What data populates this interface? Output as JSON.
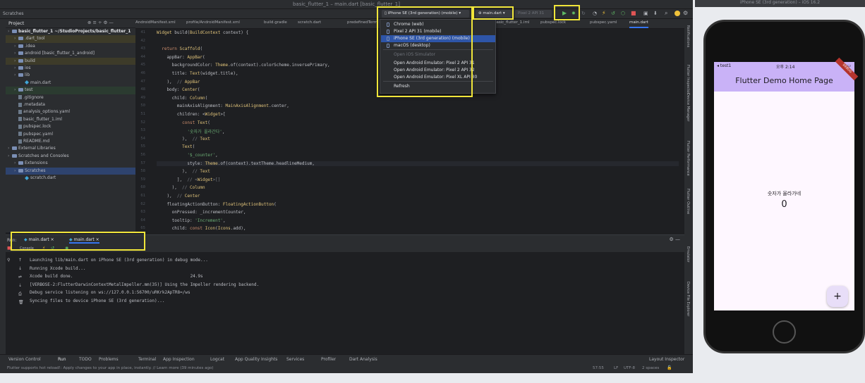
{
  "window": {
    "title": "basic_flutter_1 – main.dart [basic_flutter_1]",
    "scratches_label": "Scratches"
  },
  "toolbar": {
    "device_selector": "iPhone SE (3rd generation) (mobile)",
    "config_selector": "main.dart",
    "avd_selector": "Pixel 2 API 31"
  },
  "device_menu": {
    "items": [
      {
        "label": "Chrome (web)"
      },
      {
        "label": "Pixel 2 API 31 (mobile)"
      },
      {
        "label": "iPhone SE (3rd generation) (mobile)",
        "selected": true
      },
      {
        "label": "macOS (desktop)"
      },
      {
        "label": "Open iOS Simulator",
        "disabled": true
      },
      {
        "label": "Open Android Emulator: Pixel 2 API 31"
      },
      {
        "label": "Open Android Emulator: Pixel 2 API 32"
      },
      {
        "label": "Open Android Emulator: Pixel XL API 30"
      },
      {
        "label": "Refresh"
      }
    ]
  },
  "project": {
    "header": "Project",
    "tree": [
      {
        "label": "basic_flutter_1  ~/StudioProjects/basic_flutter_1",
        "indent": 0,
        "kind": "root"
      },
      {
        "label": ".dart_tool",
        "indent": 1,
        "kind": "folder",
        "bg": "olive"
      },
      {
        "label": ".idea",
        "indent": 1,
        "kind": "folder"
      },
      {
        "label": "android [basic_flutter_1_android]",
        "indent": 1,
        "kind": "folder"
      },
      {
        "label": "build",
        "indent": 1,
        "kind": "folder",
        "bg": "olive"
      },
      {
        "label": "ios",
        "indent": 1,
        "kind": "folder"
      },
      {
        "label": "lib",
        "indent": 1,
        "kind": "folder"
      },
      {
        "label": "main.dart",
        "indent": 2,
        "kind": "dart"
      },
      {
        "label": "test",
        "indent": 1,
        "kind": "folder",
        "bg": "green"
      },
      {
        "label": ".gitignore",
        "indent": 1,
        "kind": "file"
      },
      {
        "label": ".metadata",
        "indent": 1,
        "kind": "file"
      },
      {
        "label": "analysis_options.yaml",
        "indent": 1,
        "kind": "file"
      },
      {
        "label": "basic_flutter_1.iml",
        "indent": 1,
        "kind": "file"
      },
      {
        "label": "pubspec.lock",
        "indent": 1,
        "kind": "file"
      },
      {
        "label": "pubspec.yaml",
        "indent": 1,
        "kind": "file"
      },
      {
        "label": "README.md",
        "indent": 1,
        "kind": "file"
      },
      {
        "label": "External Libraries",
        "indent": 0,
        "kind": "folder"
      },
      {
        "label": "Scratches and Consoles",
        "indent": 0,
        "kind": "folder"
      },
      {
        "label": "Extensions",
        "indent": 1,
        "kind": "folder"
      },
      {
        "label": "Scratches",
        "indent": 1,
        "kind": "folder",
        "bg": "sel"
      },
      {
        "label": "scratch.dart",
        "indent": 2,
        "kind": "dart"
      }
    ]
  },
  "editor_tabs": [
    "AndroidManifest.xml",
    "profile/AndroidManifest.xml",
    "build.gradle",
    "scratch.dart",
    "predefinedTerm",
    "basic_flutter_1.iml",
    "pubspec.lock",
    "pubspec.yaml",
    "main.dart"
  ],
  "code": [
    {
      "n": "41",
      "text": "Widget build(BuildContext context) {"
    },
    {
      "n": "42",
      "text": ""
    },
    {
      "n": "43",
      "text": "  return Scaffold("
    },
    {
      "n": "44",
      "text": "    appBar: AppBar("
    },
    {
      "n": "45",
      "text": "      backgroundColor: Theme.of(context).colorScheme.inversePrimary,"
    },
    {
      "n": "46",
      "text": "      title: Text(widget.title),"
    },
    {
      "n": "47",
      "text": "    ),  // AppBar"
    },
    {
      "n": "48",
      "text": "    body: Center("
    },
    {
      "n": "49",
      "text": "      child: Column("
    },
    {
      "n": "50",
      "text": "        mainAxisAlignment: MainAxisAlignment.center,"
    },
    {
      "n": "51",
      "text": "        children: <Widget>["
    },
    {
      "n": "52",
      "text": "          const Text("
    },
    {
      "n": "53",
      "text": "            '숫자가 올라간다',"
    },
    {
      "n": "54",
      "text": "          ),  // Text"
    },
    {
      "n": "55",
      "text": "          Text("
    },
    {
      "n": "56",
      "text": "            '$_counter',"
    },
    {
      "n": "57",
      "text": "            style: Theme.of(context).textTheme.headlineMedium,"
    },
    {
      "n": "58",
      "text": "          ),  // Text"
    },
    {
      "n": "59",
      "text": "        ],  // <Widget>[]"
    },
    {
      "n": "60",
      "text": "      ),  // Column"
    },
    {
      "n": "61",
      "text": "    ),  // Center"
    },
    {
      "n": "62",
      "text": "    floatingActionButton: FloatingActionButton("
    },
    {
      "n": "63",
      "text": "      onPressed: _incrementCounter,"
    },
    {
      "n": "64",
      "text": "      tooltip: 'Increment',"
    },
    {
      "n": "65",
      "text": "      child: const Icon(Icons.add),"
    }
  ],
  "run": {
    "label": "Run:",
    "tabs": [
      "main.dart",
      "main.dart"
    ],
    "console_tab": "Console",
    "lines": [
      "Launching lib/main.dart on iPhone SE (3rd generation) in debug mode...",
      "Running Xcode build...",
      "Xcode build done.                                              24.9s",
      "[VERBOSE-2:FlutterDarwinContextMetalImpeller.mm(35)] Using the Impeller rendering backend.",
      "Debug service listening on ws://127.0.0.1:56700/uRKrk2ApTR8=/ws",
      "Syncing files to device iPhone SE (3rd generation)..."
    ]
  },
  "bottom_tools": [
    "Version Control",
    "Run",
    "TODO",
    "Problems",
    "Terminal",
    "App Inspection",
    "Logcat",
    "App Quality Insights",
    "Services",
    "Profiler",
    "Dart Analysis",
    "Layout Inspector"
  ],
  "status": {
    "message": "Flutter supports hot reload!: Apply changes to your app in place, instantly. // Learn more (39 minutes ago)",
    "position": "57:55",
    "line_ending": "LF",
    "encoding": "UTF-8",
    "indent": "2 spaces"
  },
  "right_tools": [
    "Notifications",
    "Flutter Inspector",
    "Device Manager",
    "Flutter Performance",
    "Flutter Outline",
    "Emulator",
    "Device File Explorer"
  ],
  "simulator": {
    "window_title": "iPhone SE (3rd generation) – iOS 16.2",
    "status_carrier": "◂ test1",
    "status_time": "오후 2:14",
    "debug_banner": "DEBUG",
    "app_title": "Flutter Demo Home Page",
    "body_label": "숫자가 올라가네",
    "counter": "0",
    "fab_label": "+"
  }
}
